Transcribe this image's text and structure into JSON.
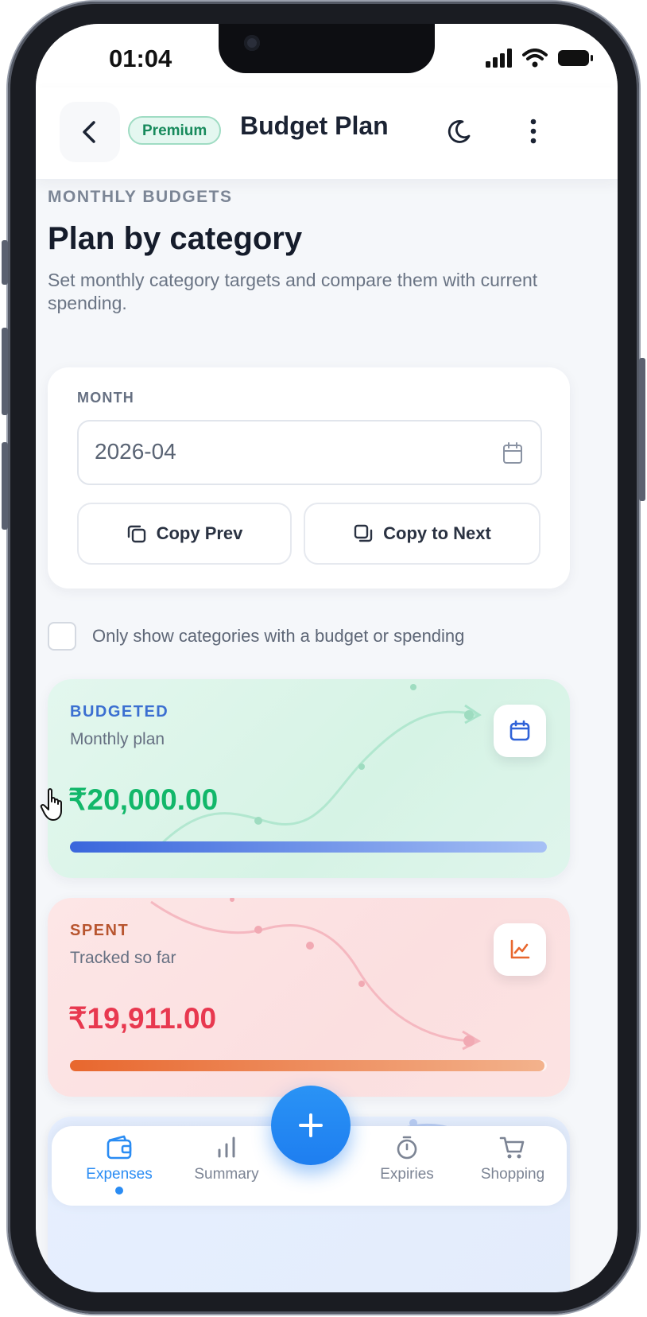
{
  "status_bar": {
    "time": "01:04"
  },
  "header": {
    "badge": "Premium",
    "title": "Budget Plan"
  },
  "page": {
    "kicker": "MONTHLY BUDGETS",
    "title": "Plan by category",
    "description": "Set monthly category targets and compare them with current spending."
  },
  "month_card": {
    "label": "MONTH",
    "value": "2026-04",
    "copy_prev": "Copy Prev",
    "copy_next": "Copy to Next"
  },
  "filter": {
    "label": "Only show categories with a budget or spending",
    "checked": false
  },
  "cards": {
    "budgeted": {
      "kicker": "BUDGETED",
      "subtitle": "Monthly plan",
      "amount": "₹20,000.00",
      "progress": 1.0,
      "accent": "#12b76a",
      "kicker_color": "#3b6fd1"
    },
    "spent": {
      "kicker": "SPENT",
      "subtitle": "Tracked so far",
      "amount": "₹19,911.00",
      "progress": 0.9956,
      "accent": "#e8384f",
      "kicker_color": "#b8552f"
    }
  },
  "tabbar": {
    "tabs": [
      {
        "label": "Expenses",
        "icon": "wallet-icon",
        "active": true
      },
      {
        "label": "Summary",
        "icon": "bar-chart-icon",
        "active": false
      },
      {
        "label": "Expiries",
        "icon": "stopwatch-icon",
        "active": false
      },
      {
        "label": "Shopping",
        "icon": "cart-icon",
        "active": false
      }
    ],
    "fab_icon": "plus-icon"
  },
  "colors": {
    "primary": "#2a8cf3",
    "premium": "#178a5c"
  }
}
